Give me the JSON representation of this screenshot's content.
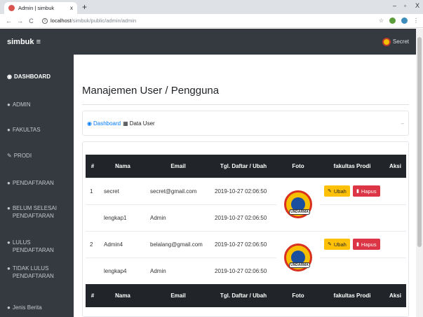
{
  "browser": {
    "tab_title": "Admin | simbuk",
    "tab_close": "x",
    "new_tab": "+",
    "win_minimize": "–",
    "win_maximize": "▫",
    "win_close": "X",
    "url_host": "localhost",
    "url_path": "/simbuk/public/admin/admin",
    "back": "←",
    "forward": "→",
    "reload": "C",
    "star": "☆",
    "menu": "⋮"
  },
  "header": {
    "brand": "simbuk ≡",
    "user": "Secret"
  },
  "sidebar": {
    "items": [
      {
        "label": "DASHBOARD",
        "icon": "tachometer-icon",
        "active": true
      },
      {
        "label": "ADMIN",
        "icon": "user-circle-icon",
        "active": false
      },
      {
        "label": "FAKULTAS",
        "icon": "user-circle-icon",
        "active": false
      },
      {
        "label": "PRODI",
        "icon": "edit-icon",
        "active": false
      },
      {
        "label": "PENDAFTARAN",
        "icon": "user-circle-icon",
        "active": false
      },
      {
        "label": "BELUM SELESAI PENDAFTARAN",
        "icon": "user-circle-icon",
        "active": false
      },
      {
        "label": "LULUS PENDAFTARAN",
        "icon": "user-circle-icon",
        "active": false
      },
      {
        "label": "TIDAK LULUS PENDAFTARAN",
        "icon": "user-circle-icon",
        "active": false
      },
      {
        "label": "Jenis Berita",
        "icon": "user-circle-icon",
        "active": false
      }
    ]
  },
  "main": {
    "page_title": "Manajemen User / Pengguna",
    "breadcrumb": {
      "link": "Dashboard",
      "current": "Data User"
    },
    "table": {
      "columns": [
        "#",
        "Nama",
        "Email",
        "Tgl. Daftar / Ubah",
        "Foto",
        "fakultas Prodi",
        "Aksi"
      ],
      "rows": [
        {
          "no": "1",
          "nama": "secret",
          "email": "secret@gmail.com",
          "tgl": "2019-10-27 02:06:50",
          "nama2": "lengkap1",
          "email2": "Admin",
          "tgl2": "2019-10-27 02:06:50"
        },
        {
          "no": "2",
          "nama": "Admin4",
          "email": "belalang@gmail.com",
          "tgl": "2019-10-27 02:06:50",
          "nama2": "lengkap4",
          "email2": "Admin",
          "tgl2": "2019-10-27 02:06:50"
        }
      ],
      "edit_label": "Ubah",
      "delete_label": "Hapus",
      "logo_text": "UNDARMA"
    }
  },
  "colors": {
    "sidebar_bg": "#343a40",
    "primary": "#007bff",
    "warning": "#ffc107",
    "danger": "#dc3545"
  }
}
